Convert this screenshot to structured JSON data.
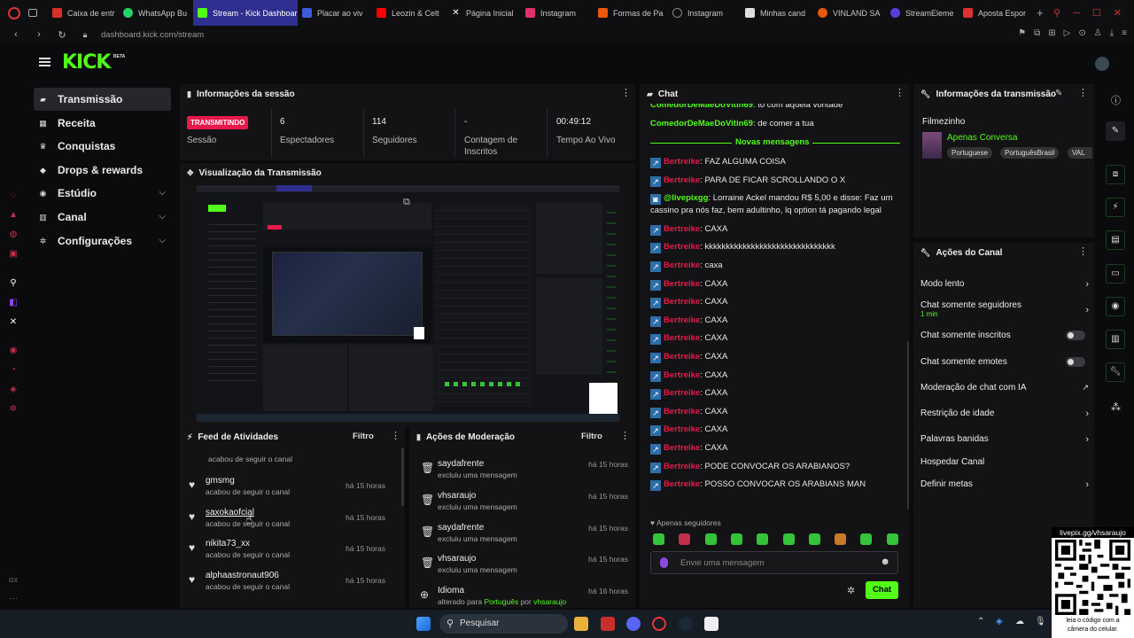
{
  "browser": {
    "tabs": [
      {
        "label": "Caixa de entr",
        "color": "#d93025"
      },
      {
        "label": "WhatsApp Bu",
        "color": "#25d366"
      },
      {
        "label": "Stream - Kick Dashboar",
        "color": "#53fc18",
        "active": true
      },
      {
        "label": "Placar ao viv",
        "color": "#3b5bdb"
      },
      {
        "label": "Leozin & Celt",
        "color": "#ff0000"
      },
      {
        "label": "Página Inicial",
        "color": "#ffffff"
      },
      {
        "label": "Instagram",
        "color": "#e1306c"
      },
      {
        "label": "Formas de Pa",
        "color": "#e8590c"
      },
      {
        "label": "Instagram",
        "color": "#888888"
      },
      {
        "label": "Minhas cand",
        "color": "#dddddd"
      },
      {
        "label": "VINLAND SA",
        "color": "#e8590c"
      },
      {
        "label": "StreamEleme",
        "color": "#5c3bdb"
      },
      {
        "label": "Aposta Espor",
        "color": "#e03131"
      }
    ],
    "url": "dashboard.kick.com/stream"
  },
  "header": {
    "logo": "KICK",
    "beta": "BETA"
  },
  "nav": {
    "items": [
      {
        "label": "Transmissão",
        "icon": "broadcast-icon",
        "selected": true
      },
      {
        "label": "Receita",
        "icon": "revenue-icon"
      },
      {
        "label": "Conquistas",
        "icon": "trophy-icon"
      },
      {
        "label": "Drops & rewards",
        "icon": "gift-icon"
      },
      {
        "label": "Estúdio",
        "icon": "studio-icon",
        "expand": true
      },
      {
        "label": "Canal",
        "icon": "channel-icon",
        "expand": true
      },
      {
        "label": "Configurações",
        "icon": "gear-icon",
        "expand": true
      }
    ]
  },
  "session": {
    "title": "Informações da sessão",
    "live_badge": "TRANSMITINDO",
    "live_label": "Sessão",
    "viewers": "6",
    "viewers_label": "Espectadores",
    "followers": "114",
    "followers_label": "Seguidores",
    "subs": "-",
    "subs_label": "Contagem de Inscritos",
    "uptime": "00:49:12",
    "uptime_label": "Tempo Ao Vivo"
  },
  "preview": {
    "title": "Visualização da Transmissão"
  },
  "activity": {
    "title": "Feed de Atividades",
    "filter": "Filtro",
    "top_sub": "acabou de seguir o canal",
    "items": [
      {
        "name": "gmsmg",
        "sub": "acabou de seguir o canal",
        "time": "há 15 horas"
      },
      {
        "name": "saxokaofcial",
        "sub": "acabou de seguir o canal",
        "time": "há 15 horas"
      },
      {
        "name": "nikita73_xx",
        "sub": "acabou de seguir o canal",
        "time": "há 15 horas"
      },
      {
        "name": "alphaastronaut906",
        "sub": "acabou de seguir o canal",
        "time": "há 15 horas"
      }
    ]
  },
  "moderation": {
    "title": "Ações de Moderação",
    "filter": "Filtro",
    "items": [
      {
        "name": "saydafrente",
        "sub": "excluiu uma mensagem",
        "time": "há 15 horas"
      },
      {
        "name": "vhsaraujo",
        "sub": "excluiu uma mensagem",
        "time": "há 15 horas"
      },
      {
        "name": "saydafrente",
        "sub": "excluiu uma mensagem",
        "time": "há 15 horas"
      },
      {
        "name": "vhsaraujo",
        "sub": "excluiu uma mensagem",
        "time": "há 15 horas"
      }
    ],
    "last": {
      "name": "Idioma",
      "sub_a": "alterado para ",
      "sub_b": "Português",
      "sub_c": " por ",
      "sub_d": "vhsaraujo",
      "time": "há 16 horas"
    }
  },
  "chat": {
    "title": "Chat",
    "top_cut": {
      "user": "ComedorDeMaeDoVitin69",
      "text": ": tô com aquela vontade"
    },
    "top2": {
      "user": "ComedorDeMaeDoVitin69",
      "text": ": de comer a tua"
    },
    "new_label": "Novas mensagens",
    "messages": [
      {
        "user": "Bertreike",
        "text": ": FAZ ALGUMA COISA"
      },
      {
        "user": "Bertreike",
        "text": ": PARA DE FICAR SCROLLANDO O X"
      },
      {
        "user": "@livepixgg",
        "text": ": Lorraine Ackel mandou R$ 5,00 e disse: Faz um",
        "text2": "cassino pra nós faz, bem adultinho, lq option tá pagando legal"
      },
      {
        "user": "Bertreike",
        "text": ": CAXA"
      },
      {
        "user": "Bertreike",
        "text": ": kkkkkkkkkkkkkkkkkkkkkkkkkkkkkkk"
      },
      {
        "user": "Bertreike",
        "text": ": caxa"
      },
      {
        "user": "Bertreike",
        "text": ": CAXA"
      },
      {
        "user": "Bertreike",
        "text": ": CAXA"
      },
      {
        "user": "Bertreike",
        "text": ": CAXA"
      },
      {
        "user": "Bertreike",
        "text": ": CAXA"
      },
      {
        "user": "Bertreike",
        "text": ": CAXA"
      },
      {
        "user": "Bertreike",
        "text": ": CAXA"
      },
      {
        "user": "Bertreike",
        "text": ": CAXA"
      },
      {
        "user": "Bertreike",
        "text": ": CAXA"
      },
      {
        "user": "Bertreike",
        "text": ": CAXA"
      },
      {
        "user": "Bertreike",
        "text": ": CAXA"
      },
      {
        "user": "Bertreike",
        "text": ": PODE CONVOCAR OS ARABIANOS?"
      },
      {
        "user": "Bertreike",
        "text": ": POSSO CONVOCAR OS ARABIANS MAN"
      }
    ],
    "followers_only": "Apenas seguidores",
    "input_placeholder": "Envie uma mensagem",
    "send_label": "Chat"
  },
  "stream_info": {
    "title": "Informações da transmissão",
    "stream_title": "Filmezinho",
    "category": "Apenas Conversa",
    "tags": [
      "Portuguese",
      "PortuguêsBrasil",
      "VAL"
    ]
  },
  "channel_actions": {
    "title": "Ações do Canal",
    "items": [
      {
        "label": "Modo lento",
        "kind": "chevron"
      },
      {
        "label": "Chat somente seguidores",
        "sub": "1 min",
        "kind": "chevron"
      },
      {
        "label": "Chat somente inscritos",
        "kind": "toggle"
      },
      {
        "label": "Chat somente emotes",
        "kind": "toggle"
      },
      {
        "label": "Moderação de chat com IA",
        "kind": "external"
      },
      {
        "label": "Restrição de idade",
        "kind": "chevron"
      },
      {
        "label": "Palavras banidas",
        "kind": "chevron"
      },
      {
        "label": "Hospedar Canal",
        "kind": "none"
      },
      {
        "label": "Definir metas",
        "kind": "chevron"
      }
    ]
  },
  "taskbar": {
    "search": "Pesquisar"
  },
  "qr": {
    "top": "livepix.gg/vhsaraujo",
    "bottom1": "leia o código com a",
    "bottom2": "câmera do celular."
  },
  "colors": {
    "kick_green": "#53fc18",
    "live_red": "#e8194a",
    "username_red": "#e8194a",
    "badge_blue": "#2e6ea8"
  }
}
